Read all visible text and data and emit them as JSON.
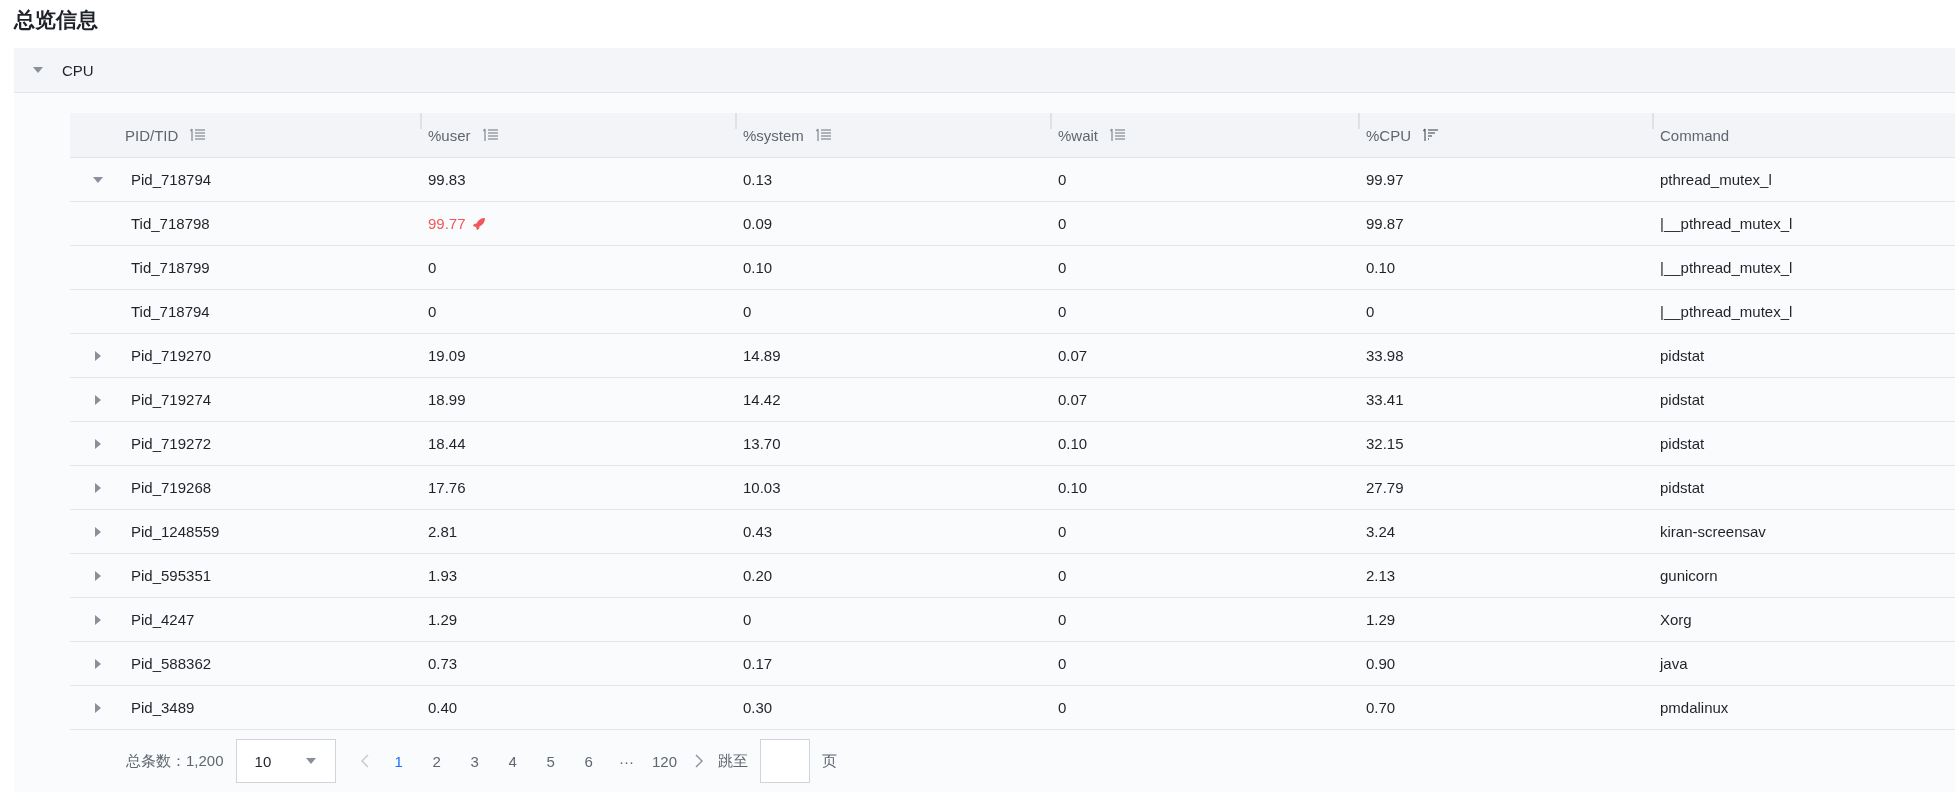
{
  "title": "总览信息",
  "section": {
    "label": "CPU",
    "expanded": true
  },
  "table": {
    "columns": [
      {
        "label": "PID/TID",
        "sortable": true,
        "sorted": false
      },
      {
        "label": "%user",
        "sortable": true,
        "sorted": false
      },
      {
        "label": "%system",
        "sortable": true,
        "sorted": false
      },
      {
        "label": "%wait",
        "sortable": true,
        "sorted": false
      },
      {
        "label": "%CPU",
        "sortable": true,
        "sorted": true
      },
      {
        "label": "Command",
        "sortable": false
      }
    ],
    "rows": [
      {
        "cells": [
          "Pid_718794",
          "99.83",
          "0.13",
          "0",
          "99.97",
          "pthread_mutex_l"
        ],
        "expanded": true,
        "children": [
          {
            "cells": [
              "Tid_718798",
              "99.77",
              "0.09",
              "0",
              "99.87",
              "|__pthread_mutex_l"
            ],
            "hot": true
          },
          {
            "cells": [
              "Tid_718799",
              "0",
              "0.10",
              "0",
              "0.10",
              "|__pthread_mutex_l"
            ],
            "hot": false
          },
          {
            "cells": [
              "Tid_718794",
              "0",
              "0",
              "0",
              "0",
              "|__pthread_mutex_l"
            ],
            "hot": false
          }
        ]
      },
      {
        "cells": [
          "Pid_719270",
          "19.09",
          "14.89",
          "0.07",
          "33.98",
          "pidstat"
        ],
        "expanded": false
      },
      {
        "cells": [
          "Pid_719274",
          "18.99",
          "14.42",
          "0.07",
          "33.41",
          "pidstat"
        ],
        "expanded": false
      },
      {
        "cells": [
          "Pid_719272",
          "18.44",
          "13.70",
          "0.10",
          "32.15",
          "pidstat"
        ],
        "expanded": false
      },
      {
        "cells": [
          "Pid_719268",
          "17.76",
          "10.03",
          "0.10",
          "27.79",
          "pidstat"
        ],
        "expanded": false
      },
      {
        "cells": [
          "Pid_1248559",
          "2.81",
          "0.43",
          "0",
          "3.24",
          "kiran-screensav"
        ],
        "expanded": false
      },
      {
        "cells": [
          "Pid_595351",
          "1.93",
          "0.20",
          "0",
          "2.13",
          "gunicorn"
        ],
        "expanded": false
      },
      {
        "cells": [
          "Pid_4247",
          "1.29",
          "0",
          "0",
          "1.29",
          "Xorg"
        ],
        "expanded": false
      },
      {
        "cells": [
          "Pid_588362",
          "0.73",
          "0.17",
          "0",
          "0.90",
          "java"
        ],
        "expanded": false
      },
      {
        "cells": [
          "Pid_3489",
          "0.40",
          "0.30",
          "0",
          "0.70",
          "pmdalinux"
        ],
        "expanded": false
      }
    ]
  },
  "pagination": {
    "total_label": "总条数：",
    "total": "1,200",
    "page_size": "10",
    "pages": [
      {
        "label": "1",
        "selected": true
      },
      {
        "label": "2",
        "selected": false
      },
      {
        "label": "3",
        "selected": false
      },
      {
        "label": "4",
        "selected": false
      },
      {
        "label": "5",
        "selected": false
      },
      {
        "label": "6",
        "selected": false
      },
      {
        "label": "···",
        "selected": false
      },
      {
        "label": "120",
        "selected": false
      }
    ],
    "jump_label": "跳至",
    "jump_suffix": "页"
  }
}
